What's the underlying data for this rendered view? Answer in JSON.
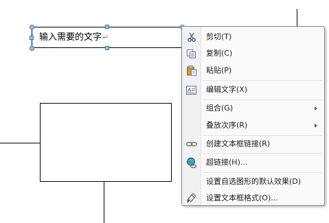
{
  "document": {
    "textbox_text": "输入需要的文字",
    "paragraph_mark": "↵"
  },
  "menu": {
    "items": [
      {
        "id": "cut",
        "label": "剪切(T)",
        "icon": "scissors-icon",
        "submenu": false
      },
      {
        "id": "copy",
        "label": "复制(C)",
        "icon": "copy-icon",
        "submenu": false
      },
      {
        "id": "paste",
        "label": "粘贴(P)",
        "icon": "paste-icon",
        "submenu": false
      },
      {
        "id": "edit-text",
        "label": "编辑文字(X)",
        "icon": "edit-text-icon",
        "submenu": false
      },
      {
        "id": "group",
        "label": "组合(G)",
        "icon": "",
        "submenu": true
      },
      {
        "id": "order",
        "label": "叠放次序(R)",
        "icon": "",
        "submenu": true
      },
      {
        "id": "create-link",
        "label": "创建文本框链接(R)",
        "icon": "chain-link-icon",
        "submenu": false
      },
      {
        "id": "hyperlink",
        "label": "超链接(H)...",
        "icon": "hyperlink-globe-icon",
        "submenu": false
      },
      {
        "id": "set-default",
        "label": "设置自选图形的默认效果(D)",
        "icon": "",
        "submenu": false
      },
      {
        "id": "format-textbox",
        "label": "设置文本框格式(O)...",
        "icon": "format-paint-icon",
        "submenu": false
      }
    ]
  },
  "colors": {
    "selection_handle_fill": "#9dc3ef",
    "selection_handle_border": "#3d6fae",
    "menu_border": "#868686",
    "menu_background": "#fafafa"
  }
}
